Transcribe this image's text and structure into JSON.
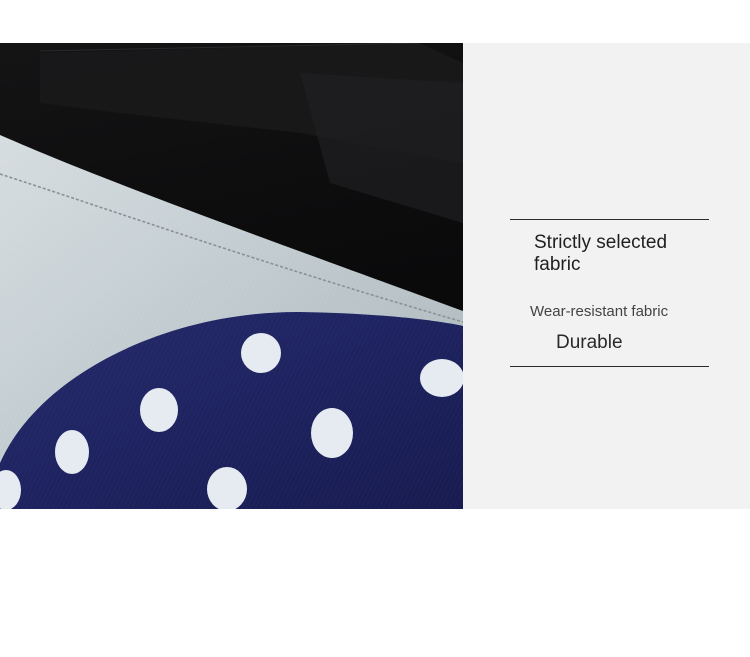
{
  "image": {
    "subject": "fabric-close-up-icon",
    "colors": {
      "lining": "#0d0d0f",
      "gray_fabric": "#c4ced1",
      "navy_fabric": "#1f2460",
      "dots": "#e6ebf2",
      "panel": "#f2f2f2"
    }
  },
  "feature_panel": {
    "headline": "Strictly selected fabric",
    "subtitle": "Wear-resistant fabric",
    "tag": "Durable"
  }
}
